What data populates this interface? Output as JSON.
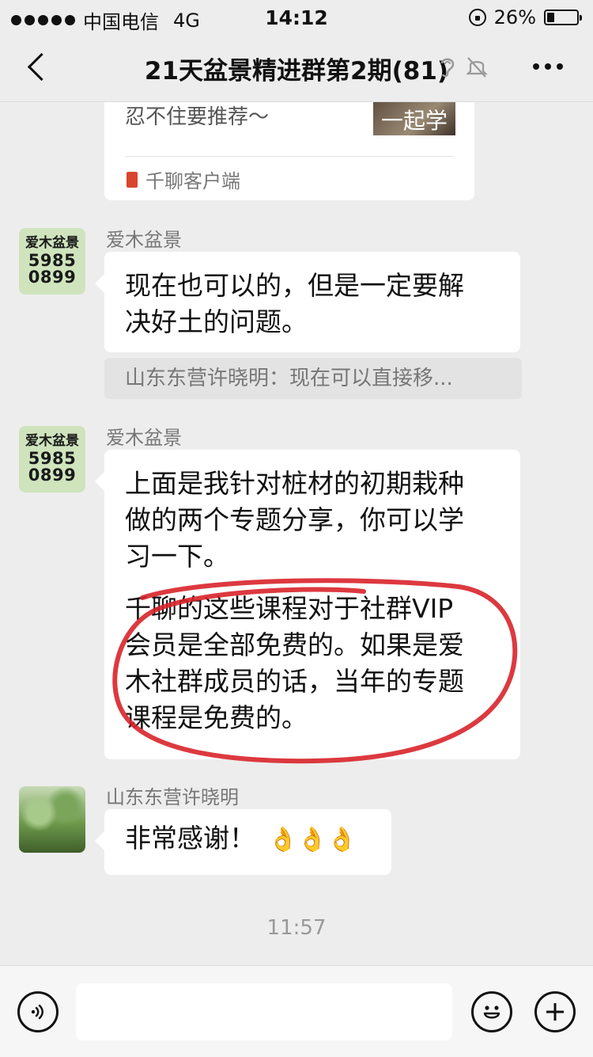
{
  "status_bar": {
    "carrier": "中国电信",
    "network": "4G",
    "time": "14:12",
    "battery": "26%",
    "battery_level": 0.26
  },
  "nav": {
    "title": "21天盆景精进群第2期(81)",
    "icons": [
      "back-icon",
      "ear-icon",
      "mute-bell-icon",
      "more-icon"
    ]
  },
  "chat": {
    "card": {
      "partial_text": "忍不住要推荐～",
      "thumb_text": "一起学",
      "app_name": "千聊客户端"
    },
    "messages": [
      {
        "sender": "爱木盆景",
        "avatar_text": [
          "爱木盆景",
          "5985",
          "0899"
        ],
        "lines": [
          "现在也可以的，但是一定要解",
          "决好土的问题。"
        ]
      },
      {
        "sender": "爱木盆景",
        "avatar_text": [
          "爱木盆景",
          "5985",
          "0899"
        ],
        "paragraphs": [
          [
            "上面是我针对桩材的初期栽种",
            "做的两个专题分享，你可以学",
            "习一下。"
          ],
          [
            "千聊的这些课程对于社群VIP",
            "会员是全部免费的。如果是爱",
            "木社群成员的话，当年的专题",
            "课程是免费的。"
          ]
        ]
      },
      {
        "sender": "山东东营许晓明",
        "text": "非常感谢！",
        "emoji": "👌👌👌"
      }
    ],
    "quote": "山东东营许晓明：现在可以直接移...",
    "timestamp": "11:57"
  },
  "input_bar": {
    "icons": [
      "voice-icon",
      "emoji-icon",
      "plus-icon"
    ],
    "value": ""
  },
  "colors": {
    "background": "#ededed",
    "annotation_red": "#d8232a"
  }
}
